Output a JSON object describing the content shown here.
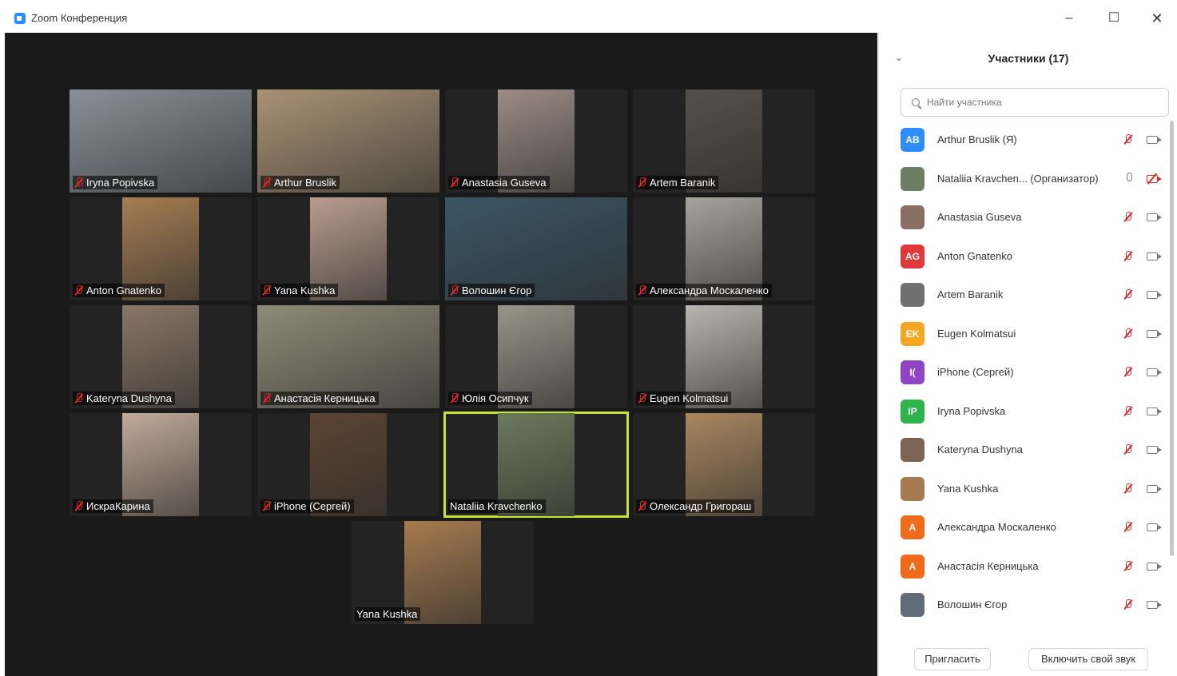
{
  "window": {
    "title": "Zoom Конференция",
    "minimize": "–",
    "maximize": "☐",
    "close": "✕"
  },
  "grid": [
    {
      "name": "Iryna Popivska",
      "muted": true,
      "bg": "#8a8f98",
      "fit": "full"
    },
    {
      "name": "Arthur Bruslik",
      "muted": true,
      "bg": "#a99275",
      "fit": "full"
    },
    {
      "name": "Anastasia Guseva",
      "muted": true,
      "bg": "#9c8c85",
      "fit": "mid"
    },
    {
      "name": "Artem Baranik",
      "muted": true,
      "bg": "#56504a",
      "fit": "mid"
    },
    {
      "name": "Anton Gnatenko",
      "muted": true,
      "bg": "#a57d52",
      "fit": "mid"
    },
    {
      "name": "Yana Kushka",
      "muted": true,
      "bg": "#b99d8f",
      "fit": "mid"
    },
    {
      "name": "Волошин Єгор",
      "muted": true,
      "bg": "#3b5566",
      "fit": "full"
    },
    {
      "name": "Александра Москаленко",
      "muted": true,
      "bg": "#a7a39d",
      "fit": "mid"
    },
    {
      "name": "Kateryna Dushyna",
      "muted": true,
      "bg": "#8a7666",
      "fit": "mid"
    },
    {
      "name": "Анастасія Керницька",
      "muted": true,
      "bg": "#8f8a78",
      "fit": "full"
    },
    {
      "name": "Юлія Осипчук",
      "muted": true,
      "bg": "#9a9489",
      "fit": "mid"
    },
    {
      "name": "Eugen Kolmatsui",
      "muted": true,
      "bg": "#b9b4ae",
      "fit": "mid"
    },
    {
      "name": "ИскраКарина",
      "muted": true,
      "bg": "#c2aa99",
      "fit": "mid"
    },
    {
      "name": "iPhone (Сергей)",
      "muted": true,
      "bg": "#5c4432",
      "fit": "mid"
    },
    {
      "name": "Nataliia Kravchenko",
      "muted": false,
      "bg": "#6c7a5c",
      "fit": "mid"
    },
    {
      "name": "Олександр Григораш",
      "muted": true,
      "bg": "#a9875f",
      "fit": "mid"
    },
    {
      "name": "Yana Kushka",
      "muted": false,
      "bg": "#a67b4f",
      "fit": "mid"
    }
  ],
  "panel": {
    "title": "Участники (17)",
    "chevron": "⌄",
    "search_placeholder": "Найти участника",
    "participants": [
      {
        "name": "Arthur Bruslik (Я)",
        "initials": "AB",
        "color": "#2d8cff",
        "mic": "muted",
        "cam": "on"
      },
      {
        "name": "Nataliia Kravchen... (Организатор)",
        "initials": "",
        "color": "#6d7f63",
        "mic": "on",
        "cam": "off"
      },
      {
        "name": "Anastasia Guseva",
        "initials": "",
        "color": "#8b6f63",
        "mic": "muted",
        "cam": "on"
      },
      {
        "name": "Anton Gnatenko",
        "initials": "AG",
        "color": "#e03a3a",
        "mic": "muted",
        "cam": "on"
      },
      {
        "name": "Artem Baranik",
        "initials": "",
        "color": "#707070",
        "mic": "muted",
        "cam": "on"
      },
      {
        "name": "Eugen Kolmatsui",
        "initials": "EK",
        "color": "#f5a623",
        "mic": "muted",
        "cam": "on"
      },
      {
        "name": "iPhone (Сергей)",
        "initials": "I(",
        "color": "#8e44c4",
        "mic": "muted",
        "cam": "on"
      },
      {
        "name": "Iryna Popivska",
        "initials": "IP",
        "color": "#2fb34f",
        "mic": "muted",
        "cam": "on"
      },
      {
        "name": "Kateryna Dushyna",
        "initials": "",
        "color": "#7a6454",
        "mic": "muted",
        "cam": "on"
      },
      {
        "name": "Yana Kushka",
        "initials": "",
        "color": "#a67b4f",
        "mic": "muted",
        "cam": "on"
      },
      {
        "name": "Александра Москаленко",
        "initials": "A",
        "color": "#f06a1c",
        "mic": "muted",
        "cam": "on"
      },
      {
        "name": "Анастасія Керницька",
        "initials": "A",
        "color": "#f06a1c",
        "mic": "muted",
        "cam": "on"
      },
      {
        "name": "Волошин Єгор",
        "initials": "",
        "color": "#5f6b76",
        "mic": "muted",
        "cam": "on"
      }
    ],
    "invite_label": "Пригласить",
    "unmute_label": "Включить свой звук"
  }
}
